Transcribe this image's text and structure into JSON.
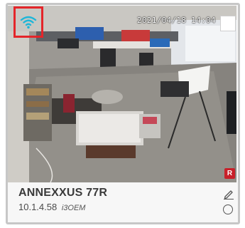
{
  "camera": {
    "name": "ANNEXXUS 77R",
    "ip": "10.1.4.58",
    "model": "i3OEM",
    "timestamp": "2021/04/18 14:04",
    "recording_badge": "R"
  },
  "icons": {
    "wifi": "wifi-icon",
    "edit": "pencil-icon",
    "status": "circle-icon",
    "select": "checkbox-icon"
  },
  "colors": {
    "highlight_border": "#e4252a",
    "wifi": "#1fb6d8",
    "recording": "#c8202a"
  }
}
